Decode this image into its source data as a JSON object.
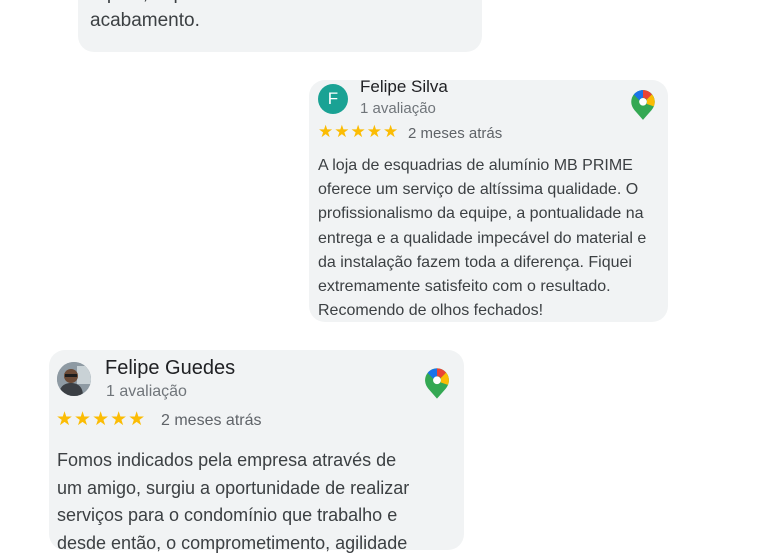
{
  "reviews": [
    {
      "text": "rápido, caprichado e com excelente\nacabamento."
    },
    {
      "initial": "F",
      "avatar_color": "#1aa294",
      "name": "Felipe Silva",
      "count": "1 avaliação",
      "stars": "★★★★★",
      "rating": 5,
      "time": "2 meses atrás",
      "text": "A loja de esquadrias de alumínio MB PRIME\noferece um serviço de altíssima qualidade. O\nprofissionalismo da equipe, a pontualidade na\nentrega e a qualidade impecável do material e\nda instalação fazem toda a diferença. Fiquei\nextremamente satisfeito com o resultado.\nRecomendo de olhos fechados!",
      "source_icon": "google-maps-pin-icon"
    },
    {
      "name": "Felipe Guedes",
      "count": "1 avaliação",
      "stars": "★★★★★",
      "rating": 5,
      "time": "2 meses atrás",
      "text": "Fomos indicados pela empresa através de\num amigo, surgiu a oportunidade de realizar\nserviços para o condomínio que trabalho e\ndesde então, o comprometimento, agilidade",
      "source_icon": "google-maps-pin-icon"
    }
  ],
  "colors": {
    "card_bg": "#f1f3f4",
    "star": "#fbbc04"
  }
}
